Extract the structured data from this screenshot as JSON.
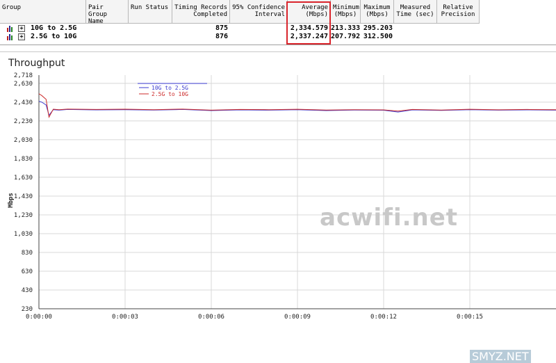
{
  "table": {
    "headers": [
      "Group",
      "Pair Group\nName",
      "Run Status",
      "Timing Records\nCompleted",
      "95% Confidence\nInterval",
      "Average\n(Mbps)",
      "Minimum\n(Mbps)",
      "Maximum\n(Mbps)",
      "Measured\nTime (sec)",
      "Relative\nPrecision"
    ],
    "rows": [
      {
        "group": "10G to 2.5G",
        "records": "875",
        "average": "2,334.579",
        "minimum": "213.333",
        "maximum": "295.203"
      },
      {
        "group": "2.5G to 10G",
        "records": "876",
        "average": "2,337.247",
        "minimum": "207.792",
        "maximum": "312.500"
      }
    ]
  },
  "graph": {
    "title": "Throughput",
    "watermark": "acwifi.net",
    "corner_watermark": "SMYZ.NET"
  },
  "chart_data": {
    "type": "line",
    "title": "Throughput",
    "ylabel": "Mbps",
    "xlabel": "",
    "ylim": [
      230,
      2718
    ],
    "xlim": [
      0,
      18
    ],
    "yticks": [
      "2,718",
      "2,630",
      "2,430",
      "2,230",
      "2,030",
      "1,830",
      "1,630",
      "1,430",
      "1,230",
      "1,030",
      "830",
      "630",
      "430",
      "230"
    ],
    "ytick_values": [
      2718,
      2630,
      2430,
      2230,
      2030,
      1830,
      1630,
      1430,
      1230,
      1030,
      830,
      630,
      430,
      230
    ],
    "xticks": [
      "0:00:00",
      "0:00:03",
      "0:00:06",
      "0:00:09",
      "0:00:12",
      "0:00:15"
    ],
    "xtick_values": [
      0,
      3,
      6,
      9,
      12,
      15
    ],
    "legend_position": "top-left",
    "series": [
      {
        "name": "10G to 2.5G",
        "color": "#3a3ad0",
        "x": [
          0,
          0.1,
          0.25,
          0.35,
          0.5,
          0.7,
          1,
          2,
          3,
          4,
          5,
          6,
          7,
          8,
          9,
          10,
          11,
          12,
          12.5,
          13,
          14,
          15,
          16,
          17,
          18
        ],
        "y": [
          2440,
          2430,
          2400,
          2290,
          2350,
          2345,
          2352,
          2348,
          2350,
          2346,
          2352,
          2340,
          2348,
          2345,
          2350,
          2340,
          2346,
          2344,
          2325,
          2348,
          2342,
          2350,
          2345,
          2348,
          2345
        ]
      },
      {
        "name": "2.5G to 10G",
        "color": "#cc2a2a",
        "x": [
          0,
          0.1,
          0.25,
          0.35,
          0.5,
          0.7,
          1,
          2,
          3,
          4,
          5,
          6,
          7,
          8,
          9,
          10,
          11,
          12,
          12.5,
          13,
          14,
          15,
          16,
          17,
          18
        ],
        "y": [
          2520,
          2500,
          2460,
          2270,
          2355,
          2350,
          2356,
          2352,
          2355,
          2350,
          2356,
          2345,
          2352,
          2350,
          2354,
          2346,
          2350,
          2348,
          2335,
          2352,
          2346,
          2354,
          2349,
          2352,
          2350
        ]
      }
    ]
  }
}
